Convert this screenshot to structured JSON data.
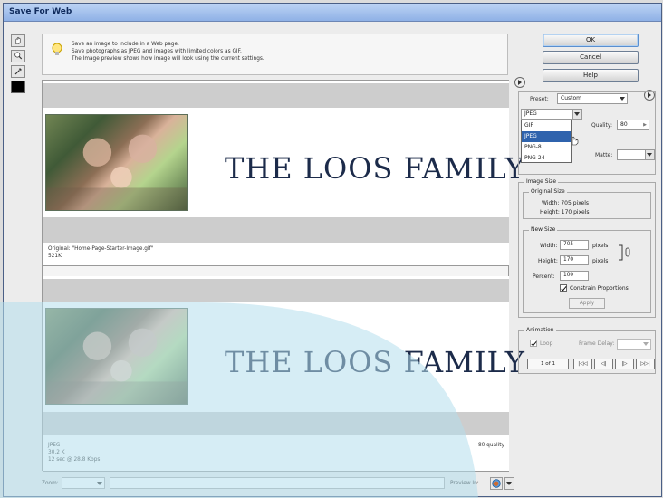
{
  "window": {
    "title": "Save For Web"
  },
  "colors": {
    "title_bar": "#a9c7f1",
    "overlay": "#b4dfec",
    "accent": "#2f63ad"
  },
  "tools": [
    "hand-icon",
    "zoom-icon",
    "eyedropper-icon"
  ],
  "hint": {
    "icon": "lightbulb-icon",
    "lines": [
      "Save an image to include in a Web page.",
      "Save photographs as JPEG and images with limited colors as GIF.",
      "The Image preview shows how image will look using the current settings."
    ]
  },
  "preview": {
    "title_text": "THE LOOS FAMILY",
    "original": {
      "name": "Original: \"Home-Page-Starter-Image.gif\"",
      "size": "521K"
    },
    "optimized": {
      "format": "JPEG",
      "size": "30.2 K",
      "time": "12 sec @ 28.8 Kbps",
      "quality": "80 quality"
    }
  },
  "bottom_bar": {
    "zoom_label": "Zoom:",
    "preview_label": "Preview In:"
  },
  "buttons": {
    "ok": "OK",
    "cancel": "Cancel",
    "help": "Help",
    "apply": "Apply"
  },
  "settings": {
    "preset_label": "Preset:",
    "preset_value": "Custom",
    "format_value": "JPEG",
    "format_options": [
      "GIF",
      "JPEG",
      "PNG-8",
      "PNG-24"
    ],
    "format_selected": "JPEG",
    "quality_label": "Quality:",
    "quality_value": "80",
    "matte_label": "Matte:"
  },
  "image_size": {
    "title": "Image Size",
    "original_title": "Original Size",
    "width_text": "Width: 705 pixels",
    "height_text": "Height: 170 pixels",
    "new_title": "New Size",
    "width_label": "Width:",
    "width_value": "705",
    "height_label": "Height:",
    "height_value": "170",
    "unit": "pixels",
    "percent_label": "Percent:",
    "percent_value": "100",
    "constrain_label": "Constrain Proportions"
  },
  "animation": {
    "title": "Animation",
    "loop_label": "Loop",
    "frame_delay_label": "Frame Delay:",
    "frame_counter": "1 of 1",
    "nav_buttons": [
      "|◁◁",
      "◁|",
      "|▷",
      "▷▷|"
    ]
  }
}
